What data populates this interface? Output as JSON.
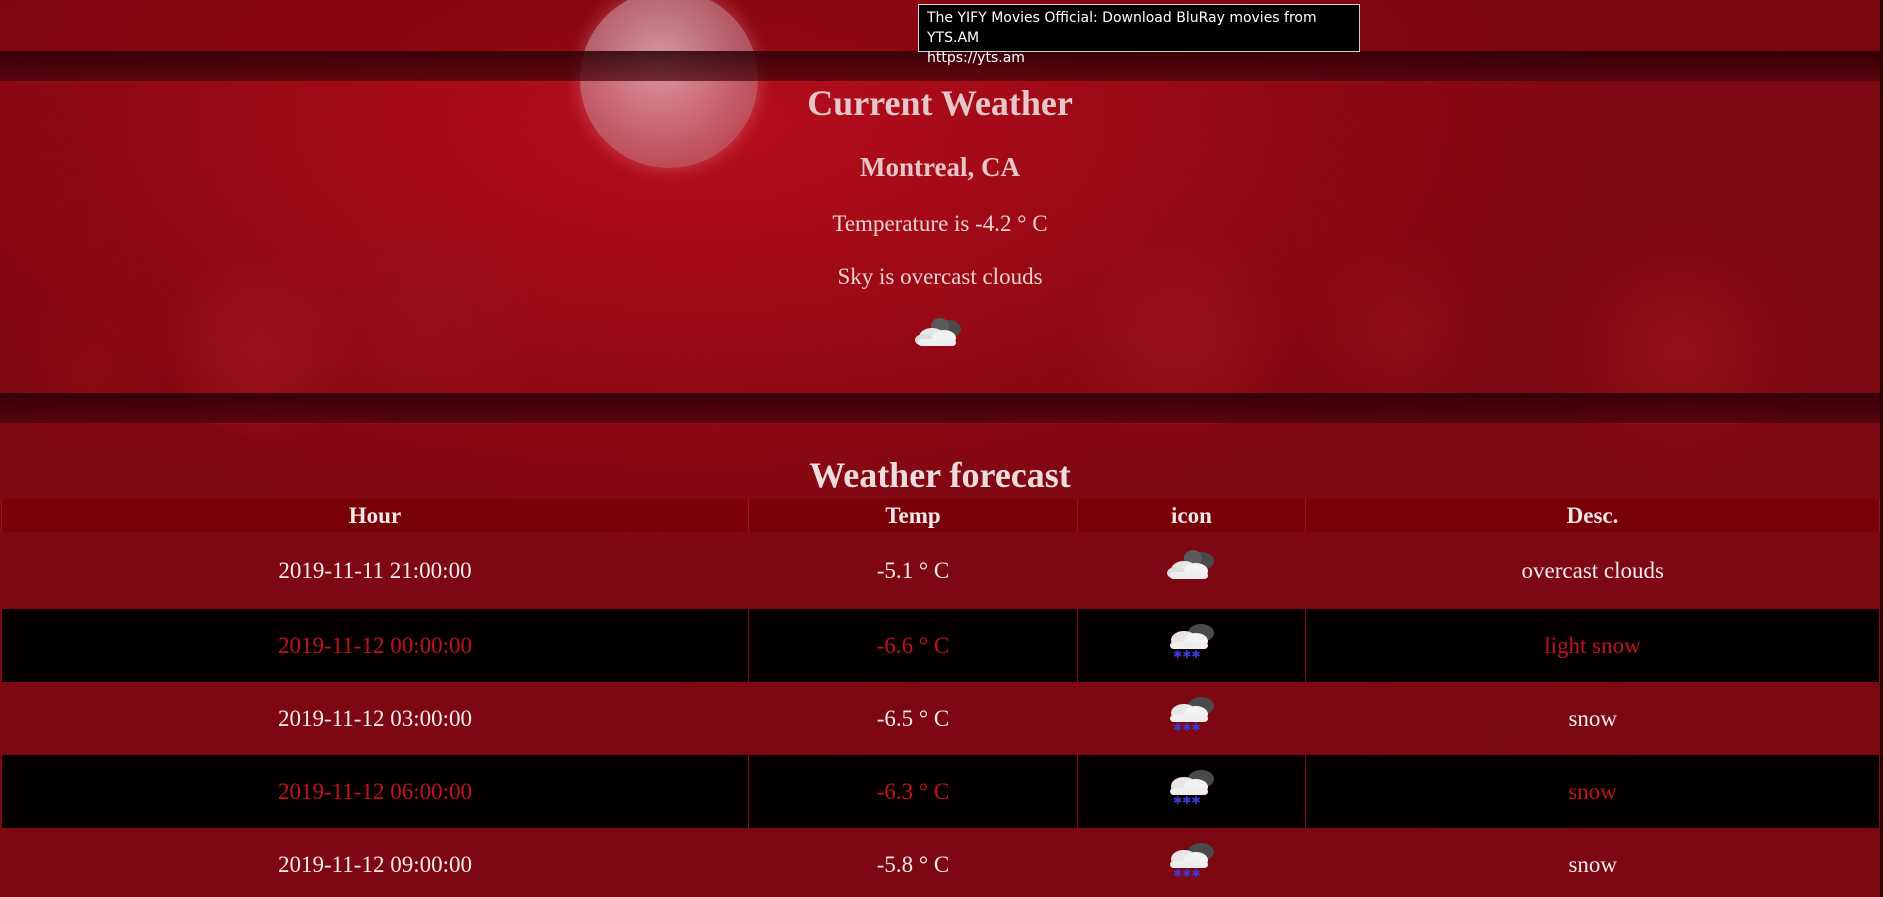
{
  "current": {
    "title": "Current Weather",
    "location": "Montreal, CA",
    "temperature_text": "Temperature is -4.2 ° C",
    "sky_text": "Sky is overcast clouds",
    "icon": "overcast-clouds-icon"
  },
  "forecast": {
    "title": "Weather forecast",
    "columns": [
      "Hour",
      "Temp",
      "icon",
      "Desc."
    ],
    "rows": [
      {
        "hour": "2019-11-11 21:00:00",
        "temp": "-5.1 ° C",
        "icon": "overcast-clouds-icon",
        "desc": "overcast clouds"
      },
      {
        "hour": "2019-11-12 00:00:00",
        "temp": "-6.6 ° C",
        "icon": "snow-icon",
        "desc": "light snow"
      },
      {
        "hour": "2019-11-12 03:00:00",
        "temp": "-6.5 ° C",
        "icon": "snow-icon",
        "desc": "snow"
      },
      {
        "hour": "2019-11-12 06:00:00",
        "temp": "-6.3 ° C",
        "icon": "snow-icon",
        "desc": "snow"
      },
      {
        "hour": "2019-11-12 09:00:00",
        "temp": "-5.8 ° C",
        "icon": "snow-icon",
        "desc": "snow"
      }
    ]
  },
  "tooltip": {
    "line1": "The YIFY Movies Official: Download BluRay movies from YTS.AM",
    "line2": "https://yts.am"
  },
  "colors": {
    "background": "#a00a17",
    "dark_row": "#050000",
    "dark_row_text": "#c0131f",
    "header_row": "#780006"
  }
}
